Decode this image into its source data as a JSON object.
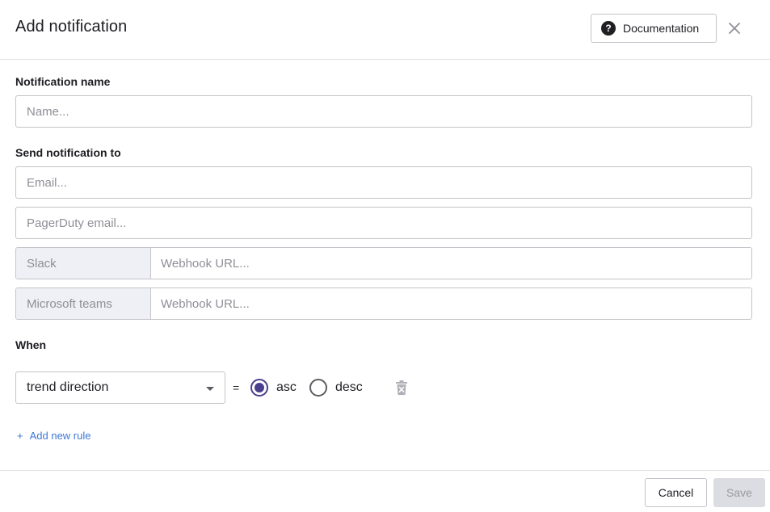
{
  "dialog": {
    "title": "Add notification",
    "documentation_label": "Documentation"
  },
  "notification_name": {
    "label": "Notification name",
    "placeholder": "Name..."
  },
  "send_to": {
    "label": "Send notification to",
    "email_placeholder": "Email...",
    "pagerduty_placeholder": "PagerDuty email...",
    "slack": {
      "prefix": "Slack",
      "placeholder": "Webhook URL..."
    },
    "teams": {
      "prefix": "Microsoft teams",
      "placeholder": "Webhook URL..."
    }
  },
  "when": {
    "label": "When",
    "rule": {
      "field": "trend direction",
      "operator": "=",
      "options": [
        {
          "label": "asc",
          "selected": true
        },
        {
          "label": "desc",
          "selected": false
        }
      ]
    },
    "add_rule_label": "Add new rule",
    "add_rule_icon": "+"
  },
  "footer": {
    "cancel_label": "Cancel",
    "save_label": "Save"
  },
  "colors": {
    "accent": "#4a3f8c",
    "link": "#3c78d8",
    "border": "#c4c4ca",
    "prefix_bg": "#eef0f5",
    "disabled_bg": "#dcdde2"
  }
}
